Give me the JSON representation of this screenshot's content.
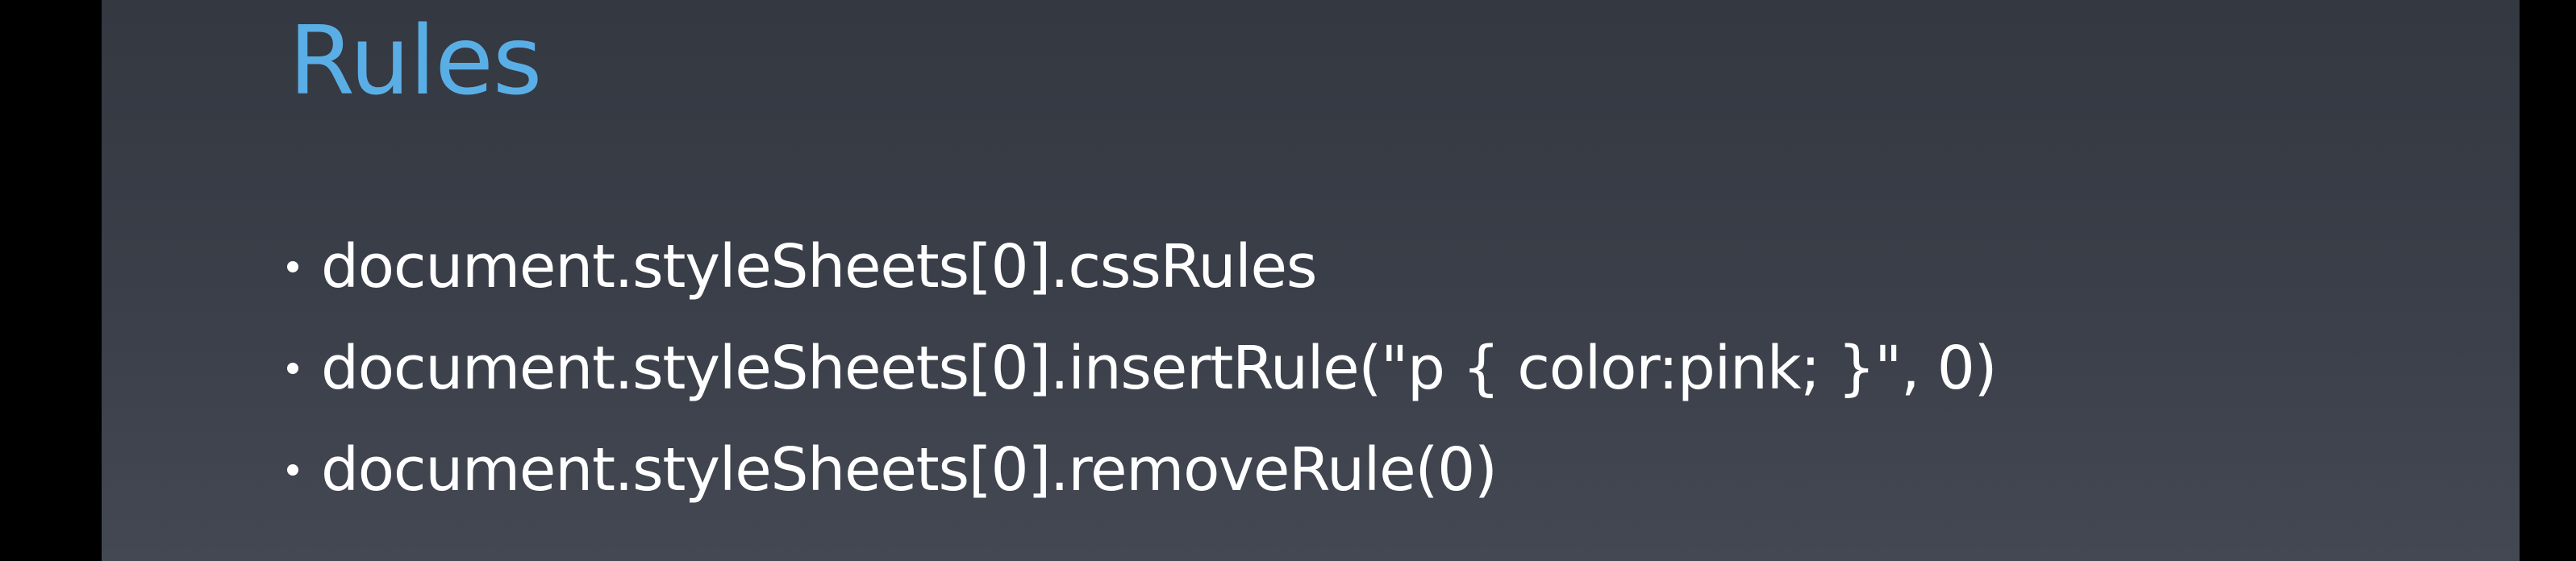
{
  "slide": {
    "title": "Rules",
    "bullets": [
      {
        "text": "document.styleSheets[0].cssRules"
      },
      {
        "text": "document.styleSheets[0].insertRule(\"p { color:pink; }\", 0)"
      },
      {
        "text": "document.styleSheets[0].removeRule(0)"
      }
    ]
  },
  "colors": {
    "title": "#5aaee6",
    "text": "#ffffff",
    "slide_background": "#3b3f49",
    "letterbox": "#000000"
  }
}
